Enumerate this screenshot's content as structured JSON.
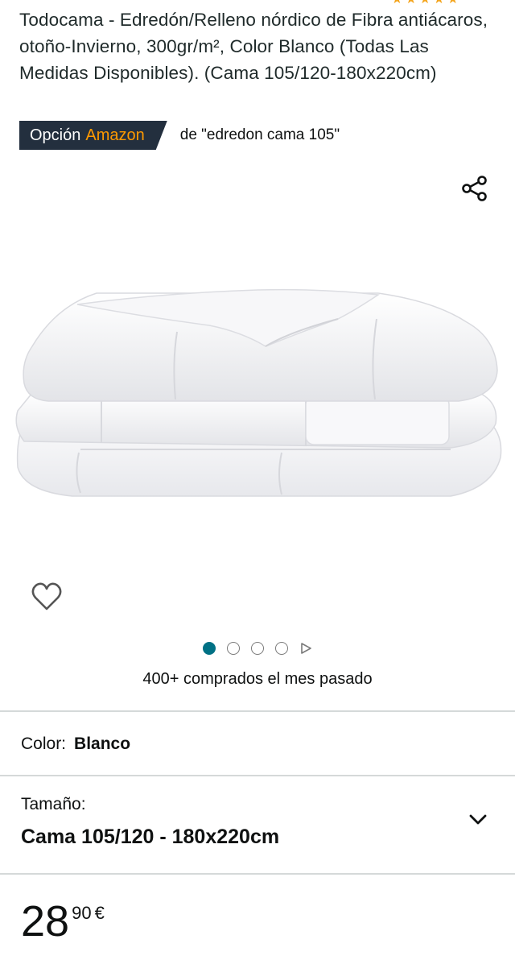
{
  "product": {
    "title": "Todocama - Edredón/Relleno nórdico de Fibra antiácaros, otoño-Invierno, 300gr/m², Color Blanco (Todas Las Medidas Disponibles). (Cama 105/120-180x220cm)",
    "rating_stars": 5
  },
  "badge": {
    "prefix": "Opción",
    "brand": "Amazon",
    "context": "de \"edredon cama 105\""
  },
  "icons": {
    "share": "share-icon",
    "heart": "heart-icon",
    "chevron": "chevron-down-icon",
    "play": "play-icon"
  },
  "gallery": {
    "current_index": 1,
    "image_count": 4,
    "has_video": true
  },
  "social_proof": "400+ comprados el mes pasado",
  "color": {
    "label": "Color:",
    "value": "Blanco"
  },
  "size": {
    "label": "Tamaño:",
    "value": "Cama 105/120 - 180x220cm"
  },
  "price": {
    "whole": "28",
    "fraction": "90",
    "currency": "€"
  },
  "colors": {
    "badge_bg": "#232f3e",
    "badge_brand": "#ff9900",
    "dot_active": "#007185",
    "star": "#f4a41b"
  }
}
